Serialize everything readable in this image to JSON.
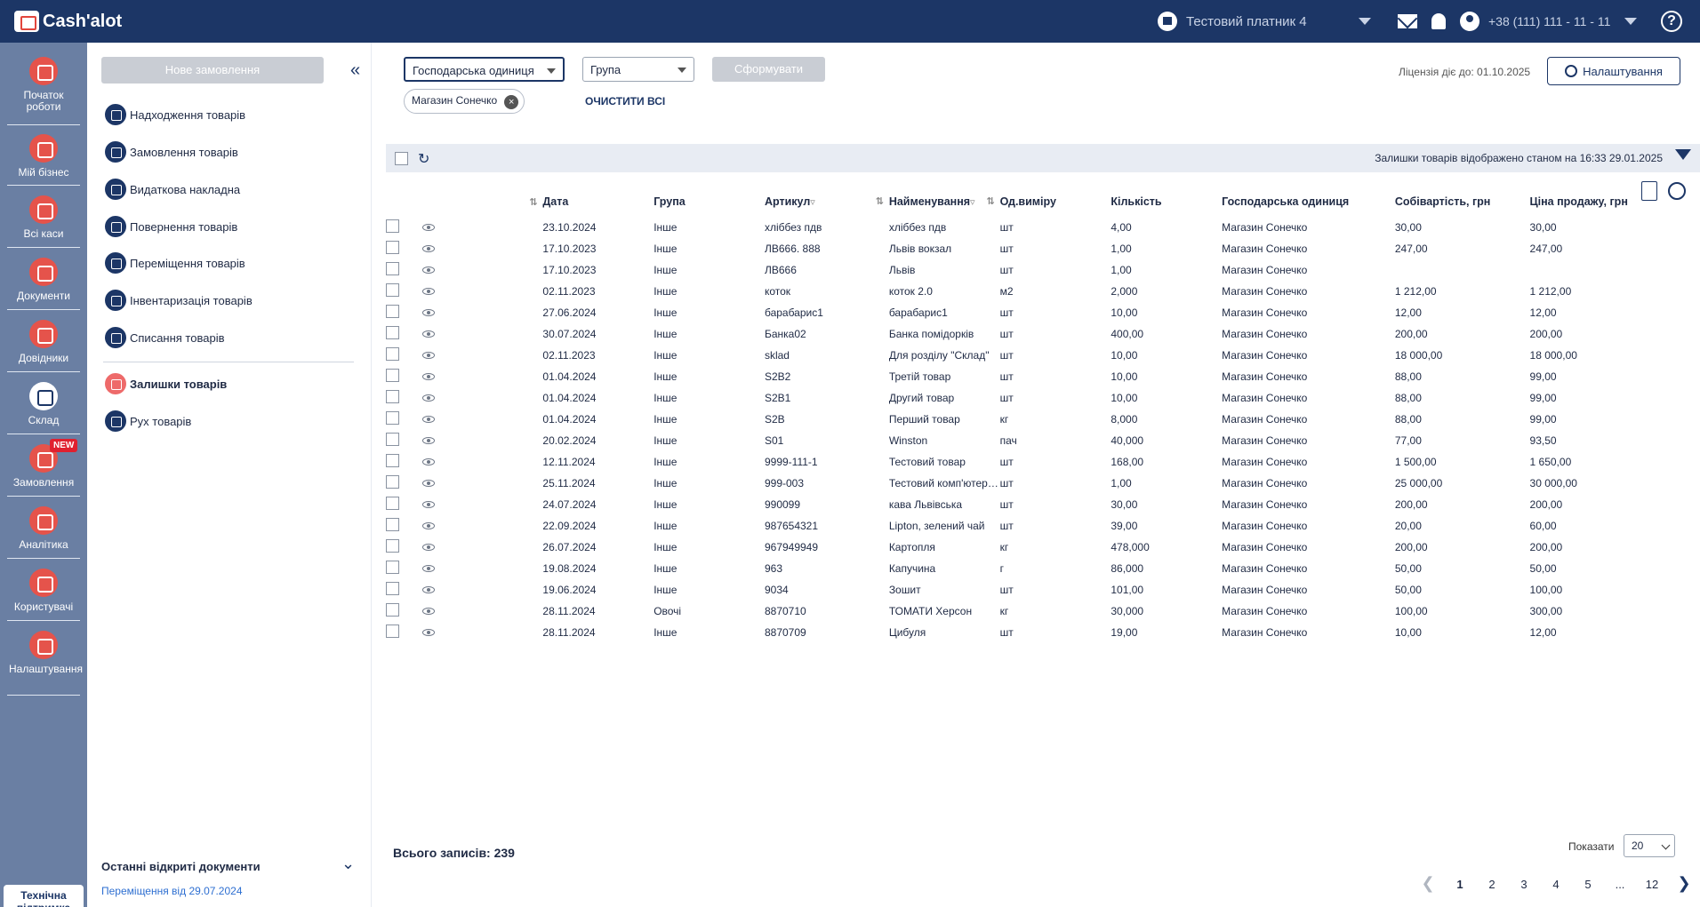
{
  "brand": {
    "name": "Cash'alot"
  },
  "header": {
    "payer": "Тестовий платник 4",
    "phone": "+38 (111) 111 - 11 - 11",
    "help": "?"
  },
  "rail": [
    {
      "label": "Початок роботи",
      "icon": "bag-icon"
    },
    {
      "label": "Мій бізнес",
      "icon": "home-icon"
    },
    {
      "label": "Всі каси",
      "icon": "cash-register-icon"
    },
    {
      "label": "Документи",
      "icon": "document-icon"
    },
    {
      "label": "Довідники",
      "icon": "book-icon"
    },
    {
      "label": "Склад",
      "icon": "warehouse-icon"
    },
    {
      "label": "Замовлення",
      "icon": "bike-icon",
      "badge": "NEW"
    },
    {
      "label": "Аналітика",
      "icon": "analytics-icon"
    },
    {
      "label": "Користувачі",
      "icon": "users-icon"
    },
    {
      "label": "Налаштування",
      "icon": "settings-icon"
    }
  ],
  "support": {
    "label": "Технічна підтримка"
  },
  "submenu": {
    "new_order": "Нове замовлення",
    "collapse": "«",
    "items": [
      "Надходження товарів",
      "Замовлення товарів",
      "Видаткова накладна",
      "Повернення товарів",
      "Переміщення товарів",
      "Інвентаризація товарів",
      "Списання товарів",
      "Залишки товарів",
      "Рух товарів"
    ],
    "recent_title": "Останні відкриті документи",
    "recent_toggle": "⌄",
    "recent_link": "Переміщення від 29.07.2024"
  },
  "filters": {
    "unit_select": "Господарська одиниця",
    "group_select": "Група",
    "form_button": "Сформувати",
    "chip": "Магазин Сонечко",
    "chip_remove": "×",
    "clear_all": "ОЧИСТИТИ ВСІ",
    "license": "Ліцензія діє до: 01.10.2025",
    "settings": "Налаштування"
  },
  "toolbar": {
    "refresh": "↻",
    "note": "Залишки товарів відображено станом на 16:33 29.01.2025"
  },
  "table": {
    "sort_mark": "⇅",
    "filter_mark": "▿",
    "columns": [
      "Дата",
      "Група",
      "Артикул",
      "Найменування",
      "Од.виміру",
      "Кількість",
      "Господарська одиниця",
      "Собівартість, грн",
      "Ціна продажу, грн"
    ],
    "rows": [
      [
        "23.10.2024",
        "Інше",
        "хліббез пдв",
        "хліббез пдв",
        "шт",
        "4,00",
        "Магазин Сонечко",
        "30,00",
        "30,00"
      ],
      [
        "17.10.2023",
        "Інше",
        "ЛВ666. 888",
        "Львів вокзал",
        "шт",
        "1,00",
        "Магазин Сонечко",
        "247,00",
        "247,00"
      ],
      [
        "17.10.2023",
        "Інше",
        "ЛВ666",
        "Львів",
        "шт",
        "1,00",
        "Магазин Сонечко",
        "",
        ""
      ],
      [
        "02.11.2023",
        "Інше",
        "коток",
        "коток 2.0",
        "м2",
        "2,000",
        "Магазин Сонечко",
        "1 212,00",
        "1 212,00"
      ],
      [
        "27.06.2024",
        "Інше",
        "барабарис1",
        "барабарис1",
        "шт",
        "10,00",
        "Магазин Сонечко",
        "12,00",
        "12,00"
      ],
      [
        "30.07.2024",
        "Інше",
        "Банка02",
        "Банка помідорків",
        "шт",
        "400,00",
        "Магазин Сонечко",
        "200,00",
        "200,00"
      ],
      [
        "02.11.2023",
        "Інше",
        "sklad",
        "Для розділу \"Склад\"",
        "шт",
        "10,00",
        "Магазин Сонечко",
        "18 000,00",
        "18 000,00"
      ],
      [
        "01.04.2024",
        "Інше",
        "S2B2",
        "Третій товар",
        "шт",
        "10,00",
        "Магазин Сонечко",
        "88,00",
        "99,00"
      ],
      [
        "01.04.2024",
        "Інше",
        "S2B1",
        "Другий товар",
        "шт",
        "10,00",
        "Магазин Сонечко",
        "88,00",
        "99,00"
      ],
      [
        "01.04.2024",
        "Інше",
        "S2B",
        "Перший товар",
        "кг",
        "8,000",
        "Магазин Сонечко",
        "88,00",
        "99,00"
      ],
      [
        "20.02.2024",
        "Інше",
        "S01",
        "Winston",
        "пач",
        "40,000",
        "Магазин Сонечко",
        "77,00",
        "93,50"
      ],
      [
        "12.11.2024",
        "Інше",
        "9999-111-1",
        "Тестовий товар",
        "шт",
        "168,00",
        "Магазин Сонечко",
        "1 500,00",
        "1 650,00"
      ],
      [
        "25.11.2024",
        "Інше",
        "999-003",
        "Тестовий комп'ютер д...",
        "шт",
        "1,00",
        "Магазин Сонечко",
        "25 000,00",
        "30 000,00"
      ],
      [
        "24.07.2024",
        "Інше",
        "990099",
        "кава Львівська",
        "шт",
        "30,00",
        "Магазин Сонечко",
        "200,00",
        "200,00"
      ],
      [
        "22.09.2024",
        "Інше",
        "987654321",
        "Lipton, зелений чай",
        "шт",
        "39,00",
        "Магазин Сонечко",
        "20,00",
        "60,00"
      ],
      [
        "26.07.2024",
        "Інше",
        "967949949",
        "Картопля",
        "кг",
        "478,000",
        "Магазин Сонечко",
        "200,00",
        "200,00"
      ],
      [
        "19.08.2024",
        "Інше",
        "963",
        "Капучина",
        "г",
        "86,000",
        "Магазин Сонечко",
        "50,00",
        "50,00"
      ],
      [
        "19.06.2024",
        "Інше",
        "9034",
        "Зошит",
        "шт",
        "101,00",
        "Магазин Сонечко",
        "50,00",
        "100,00"
      ],
      [
        "28.11.2024",
        "Овочі",
        "8870710",
        "ТОМАТИ Херсон",
        "кг",
        "30,000",
        "Магазин Сонечко",
        "100,00",
        "300,00"
      ],
      [
        "28.11.2024",
        "Інше",
        "8870709",
        "Цибуля",
        "шт",
        "19,00",
        "Магазин Сонечко",
        "10,00",
        "12,00"
      ]
    ]
  },
  "footer": {
    "total": "Всього записів: 239",
    "show_label": "Показати",
    "per_page": "20",
    "pages": [
      "1",
      "2",
      "3",
      "4",
      "5",
      "...",
      "12"
    ],
    "current_page": "1",
    "prev": "❮",
    "next": "❯"
  }
}
